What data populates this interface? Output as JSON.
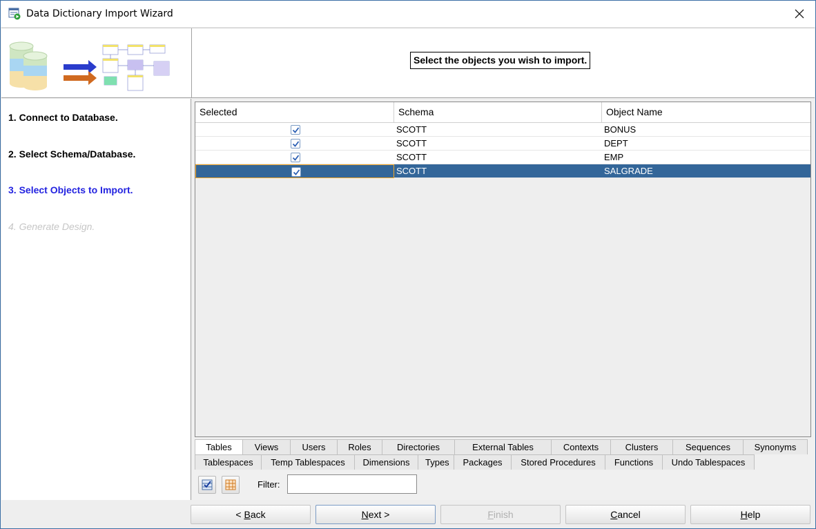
{
  "window": {
    "title": "Data Dictionary Import Wizard",
    "close_glyph": "✕"
  },
  "header": {
    "caption": "Select the objects you wish to import."
  },
  "steps": [
    {
      "label": "1. Connect to Database.",
      "state": "done"
    },
    {
      "label": "2. Select Schema/Database.",
      "state": "done"
    },
    {
      "label": "3. Select Objects to Import.",
      "state": "active"
    },
    {
      "label": "4. Generate Design.",
      "state": "pending"
    }
  ],
  "grid": {
    "columns": [
      "Selected",
      "Schema",
      "Object Name"
    ],
    "rows": [
      {
        "selected": true,
        "schema": "SCOTT",
        "object_name": "BONUS",
        "highlighted": false
      },
      {
        "selected": true,
        "schema": "SCOTT",
        "object_name": "DEPT",
        "highlighted": false
      },
      {
        "selected": true,
        "schema": "SCOTT",
        "object_name": "EMP",
        "highlighted": false
      },
      {
        "selected": true,
        "schema": "SCOTT",
        "object_name": "SALGRADE",
        "highlighted": true
      }
    ]
  },
  "tabs": {
    "row1": [
      "Tables",
      "Views",
      "Users",
      "Roles",
      "Directories",
      "External Tables",
      "Contexts",
      "Clusters",
      "Sequences",
      "Synonyms"
    ],
    "row2": [
      "Tablespaces",
      "Temp Tablespaces",
      "Dimensions",
      "Types",
      "Packages",
      "Stored Procedures",
      "Functions",
      "Undo Tablespaces"
    ],
    "active": "Tables"
  },
  "toolbar": {
    "select_all_icon": "check-all-icon",
    "deselect_all_icon": "uncheck-all-icon",
    "filter_label": "Filter:",
    "filter_value": ""
  },
  "buttons": {
    "back": {
      "prefix": "< ",
      "mnemonic": "B",
      "rest": "ack"
    },
    "next": {
      "mnemonic": "N",
      "rest": "ext >"
    },
    "finish": {
      "mnemonic": "F",
      "rest": "inish"
    },
    "cancel": {
      "mnemonic": "C",
      "rest": "ancel"
    },
    "help": {
      "mnemonic": "H",
      "rest": "elp"
    }
  },
  "colors": {
    "selection": "#336699",
    "active_step": "#2323e0",
    "disabled_text": "#c6c6c6"
  }
}
